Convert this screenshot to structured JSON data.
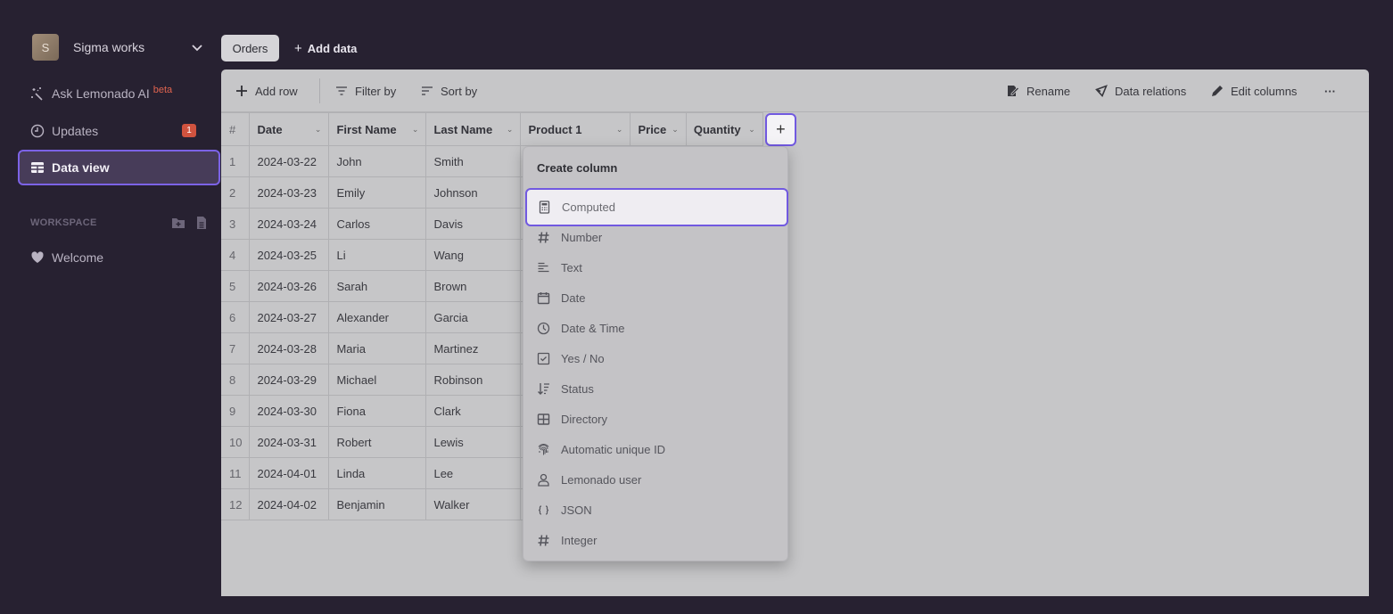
{
  "workspace": {
    "avatar_letter": "S",
    "name": "Sigma works"
  },
  "sidebar": {
    "ai": {
      "label": "Ask Lemonado AI",
      "badge": "beta"
    },
    "updates": {
      "label": "Updates",
      "count": "1"
    },
    "data_view": {
      "label": "Data view"
    },
    "section_label": "WORKSPACE",
    "welcome": {
      "label": "Welcome"
    }
  },
  "tabs": {
    "orders": "Orders",
    "add_data": "Add data"
  },
  "toolbar": {
    "add_row": "Add row",
    "filter_by": "Filter by",
    "sort_by": "Sort by",
    "rename": "Rename",
    "data_relations": "Data relations",
    "edit_columns": "Edit columns",
    "more": "···"
  },
  "table": {
    "columns": [
      "#",
      "Date",
      "First Name",
      "Last Name",
      "Product 1",
      "Price",
      "Quantity"
    ],
    "add_column": "+",
    "rows": [
      [
        "1",
        "2024-03-22",
        "John",
        "Smith"
      ],
      [
        "2",
        "2024-03-23",
        "Emily",
        "Johnson"
      ],
      [
        "3",
        "2024-03-24",
        "Carlos",
        "Davis"
      ],
      [
        "4",
        "2024-03-25",
        "Li",
        "Wang"
      ],
      [
        "5",
        "2024-03-26",
        "Sarah",
        "Brown"
      ],
      [
        "6",
        "2024-03-27",
        "Alexander",
        "Garcia"
      ],
      [
        "7",
        "2024-03-28",
        "Maria",
        "Martinez"
      ],
      [
        "8",
        "2024-03-29",
        "Michael",
        "Robinson"
      ],
      [
        "9",
        "2024-03-30",
        "Fiona",
        "Clark"
      ],
      [
        "10",
        "2024-03-31",
        "Robert",
        "Lewis"
      ],
      [
        "11",
        "2024-04-01",
        "Linda",
        "Lee"
      ],
      [
        "12",
        "2024-04-02",
        "Benjamin",
        "Walker"
      ]
    ]
  },
  "create_column_menu": {
    "title": "Create column",
    "items": [
      {
        "label": "Computed",
        "icon": "calculator-icon"
      },
      {
        "label": "Number",
        "icon": "hash-icon"
      },
      {
        "label": "Text",
        "icon": "text-lines-icon"
      },
      {
        "label": "Date",
        "icon": "calendar-icon"
      },
      {
        "label": "Date & Time",
        "icon": "clock-icon"
      },
      {
        "label": "Yes / No",
        "icon": "checkbox-icon"
      },
      {
        "label": "Status",
        "icon": "status-sort-icon"
      },
      {
        "label": "Directory",
        "icon": "table-grid-icon"
      },
      {
        "label": "Automatic unique ID",
        "icon": "fingerprint-icon"
      },
      {
        "label": "Lemonado user",
        "icon": "user-icon"
      },
      {
        "label": "JSON",
        "icon": "braces-icon"
      },
      {
        "label": "Integer",
        "icon": "hash-icon"
      }
    ]
  },
  "colors": {
    "accent": "#7159e0",
    "badge": "#d0533f",
    "background": "#272131",
    "panel": "#c6c6c8"
  }
}
